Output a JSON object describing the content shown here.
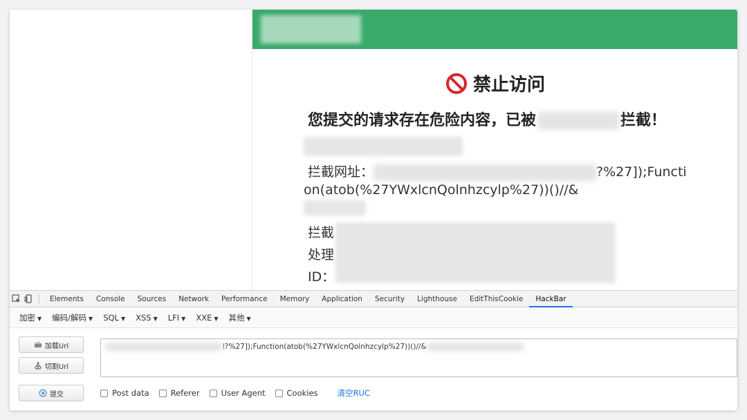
{
  "waf": {
    "title": "禁止访问",
    "message_prefix": "您提交的请求存在危险内容，已被",
    "message_suffix": "拦截！",
    "url_label": "拦截网址：",
    "url_line1_tail": "?%27]);Functi",
    "url_line2": "on(atob(%27YWxlcnQolnhzcylp%27))()//&",
    "label_intercept_prefix": "拦截",
    "label_handle_prefix": "处理",
    "label_id": "ID："
  },
  "devtools": {
    "tabs": [
      "Elements",
      "Console",
      "Sources",
      "Network",
      "Performance",
      "Memory",
      "Application",
      "Security",
      "Lighthouse",
      "EditThisCookie",
      "HackBar"
    ],
    "active_tab": "HackBar"
  },
  "hackbar": {
    "menu": [
      "加密",
      "编码/解码",
      "SQL",
      "XSS",
      "LFI",
      "XXE",
      "其他"
    ],
    "buttons": {
      "load_url": "加载Url",
      "split_url": "切割Url",
      "submit": "提交"
    },
    "url_visible": "l?%27]);Function(atob(%27YWxlcnQolnhzcylp%27))()//&",
    "options": [
      "Post data",
      "Referer",
      "User Agent",
      "Cookies"
    ],
    "clear_link": "清空RUC"
  },
  "colors": {
    "waf_header": "#3aaa6b",
    "forbid_red": "#d9262b",
    "active_tab_underline": "#1a73e8"
  }
}
